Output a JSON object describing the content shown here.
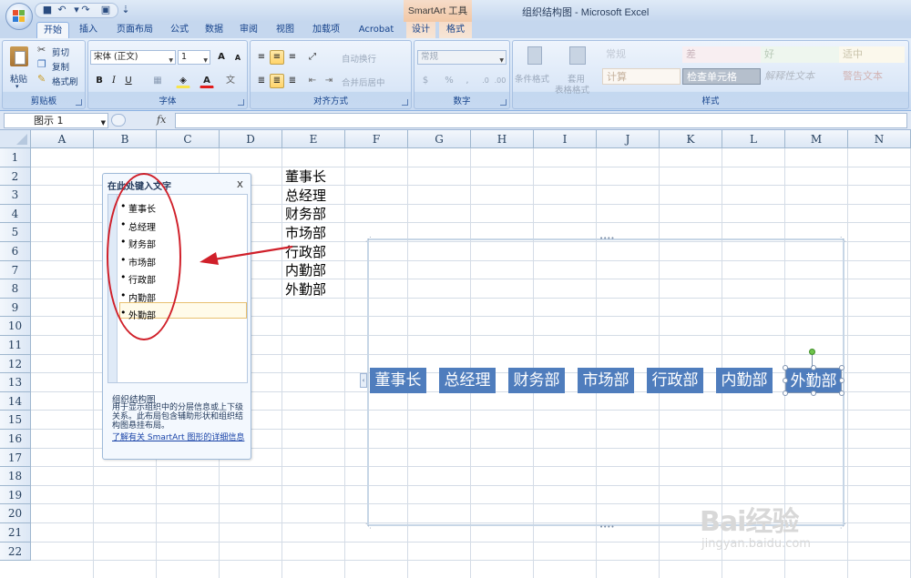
{
  "window": {
    "title": "组织结构图 - Microsoft Excel",
    "contextual_tab_group": "SmartArt 工具"
  },
  "tabs": [
    {
      "label": "开始",
      "active": true
    },
    {
      "label": "插入"
    },
    {
      "label": "页面布局"
    },
    {
      "label": "公式"
    },
    {
      "label": "数据"
    },
    {
      "label": "审阅"
    },
    {
      "label": "视图"
    },
    {
      "label": "加载项"
    },
    {
      "label": "Acrobat"
    },
    {
      "label": "设计",
      "contextual": true
    },
    {
      "label": "格式",
      "contextual": true
    }
  ],
  "ribbon": {
    "clipboard": {
      "label": "剪贴板",
      "paste": "粘贴",
      "cut": "剪切",
      "copy": "复制",
      "format_painter": "格式刷"
    },
    "font": {
      "label": "字体",
      "font_name": "宋体 (正文)",
      "font_size": "1",
      "bold": "B",
      "italic": "I",
      "underline": "U",
      "grow": "A",
      "shrink": "A"
    },
    "alignment": {
      "label": "对齐方式",
      "wrap_text": "自动换行",
      "merge_center": "合并后居中"
    },
    "number": {
      "label": "数字",
      "format": "常规"
    },
    "styles": {
      "label": "样式",
      "conditional_format": "条件格式",
      "table_format_1": "套用",
      "table_format_2": "表格格式",
      "cells": [
        {
          "label": "常规",
          "color": "#c0c8d4",
          "bg": "#ffffff"
        },
        {
          "label": "差",
          "color": "#c9b4bc",
          "bg": "#f8eef1"
        },
        {
          "label": "好",
          "color": "#b7c8b6",
          "bg": "#eef6ee"
        },
        {
          "label": "适中",
          "color": "#c8c2aa",
          "bg": "#fbf8ec"
        },
        {
          "label": "计算",
          "color": "#c4b09c",
          "bg": "#fbf7f2"
        },
        {
          "label": "检查单元格",
          "color": "#ffffff",
          "bg": "#b5bfcc"
        },
        {
          "label": "解释性文本",
          "color": "#b1b8c2",
          "bg": "#ffffff"
        },
        {
          "label": "警告文本",
          "color": "#d2b4b4",
          "bg": "#ffffff"
        }
      ]
    }
  },
  "formula_bar": {
    "name_box": "图示 1",
    "fx": "fx",
    "formula": ""
  },
  "grid": {
    "columns": [
      "A",
      "B",
      "C",
      "D",
      "E",
      "F",
      "G",
      "H",
      "I",
      "J",
      "K",
      "L",
      "M",
      "N"
    ],
    "rows": [
      "1",
      "2",
      "3",
      "4",
      "5",
      "6",
      "7",
      "8",
      "9",
      "10",
      "11",
      "12",
      "13",
      "14",
      "15",
      "16",
      "17",
      "18",
      "19",
      "20",
      "21",
      "22"
    ],
    "column_e_cells": [
      "董事长",
      "总经理",
      "财务部",
      "市场部",
      "行政部",
      "内勤部",
      "外勤部"
    ]
  },
  "text_pane": {
    "title": "在此处键入文字",
    "close": "x",
    "items": [
      "董事长",
      "总经理",
      "财务部",
      "市场部",
      "行政部",
      "内勤部",
      "外勤部"
    ],
    "description_title": "组织结构图",
    "description": "用于显示组织中的分层信息或上下级关系。此布局包含辅助形状和组织结构图悬挂布局。",
    "learn_more": "了解有关 SmartArt 图形的详细信息"
  },
  "smartart": {
    "nodes": [
      "董事长",
      "总经理",
      "财务部",
      "市场部",
      "行政部",
      "内勤部",
      "外勤部"
    ],
    "node_color": "#4f7dbd",
    "selected_node": "外勤部"
  },
  "annotation": {
    "color": "#d0202a"
  },
  "watermark": {
    "brand": "Bai经验",
    "url": "jingyan.baidu.com"
  }
}
